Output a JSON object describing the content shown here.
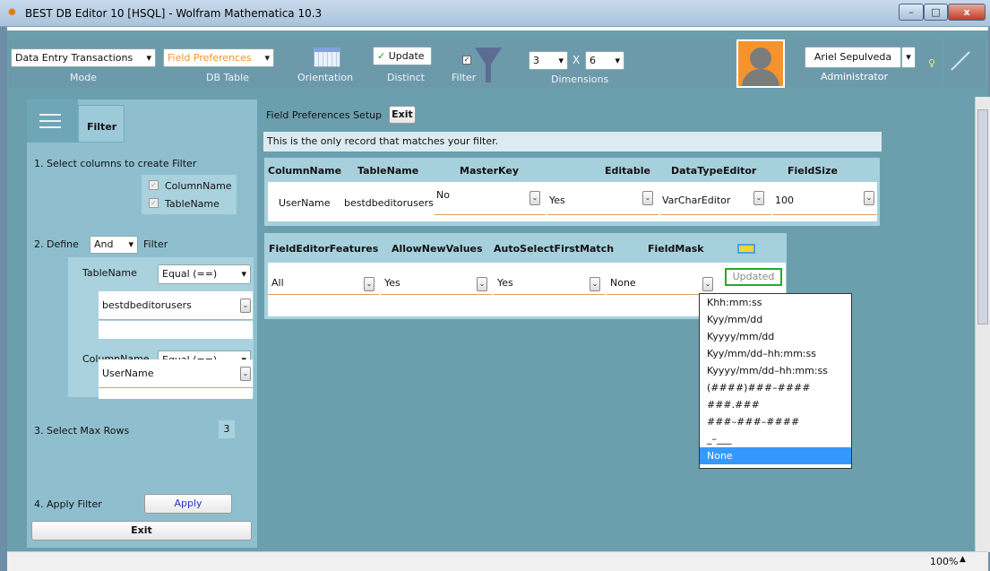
{
  "window": {
    "title": "BEST DB Editor 10 [HSQL] - Wolfram Mathematica 10.3",
    "min": "–",
    "max": "□",
    "close": "x"
  },
  "toolbar": {
    "mode_value": "Data Entry Transactions",
    "mode_label": "Mode",
    "table_value": "Field Preferences",
    "table_label": "DB Table",
    "orientation_label": "Orientation",
    "update_label": "Update",
    "distinct_label": "Distinct",
    "filter_label": "Filter",
    "dim_rows": "3",
    "dim_x": "X",
    "dim_cols": "6",
    "dim_label": "Dimensions",
    "user_name": "Ariel Sepulveda",
    "user_role": "Administrator"
  },
  "sidebar": {
    "tab_label": "Filter",
    "step1": "1.  Select columns to create Filter",
    "cols": [
      "ColumnName",
      "TableName"
    ],
    "step2_prefix": "2.  Define",
    "step2_op": "And",
    "step2_suffix": "Filter",
    "f1_name": "TableName",
    "f1_op": "Equal (==)",
    "f1_value": "bestdbeditorusers",
    "f2_name": "ColumnName",
    "f2_op": "Equal (==)",
    "f2_value": "UserName",
    "step3": "3.  Select Max Rows",
    "max_rows": "3",
    "step4": "4.  Apply Filter",
    "apply": "Apply",
    "exit": "Exit"
  },
  "main": {
    "setup_title": "Field Preferences Setup",
    "exit": "Exit",
    "message": "This is the only record that matches your filter.",
    "t1_headers": [
      "ColumnName",
      "TableName",
      "MasterKey",
      "Editable",
      "DataTypeEditor",
      "FieldSize"
    ],
    "t1_row": {
      "col": "UserName",
      "table": "bestdbeditorusers",
      "masterkey": "No",
      "editable": "Yes",
      "datatype": "VarCharEditor",
      "fieldsize": "100"
    },
    "t2_headers": [
      "FieldEditorFeatures",
      "AllowNewValues",
      "AutoSelectFirstMatch",
      "FieldMask"
    ],
    "t2_row": {
      "features": "All",
      "allownew": "Yes",
      "autoselect": "Yes",
      "mask": "None"
    },
    "updated": "Updated"
  },
  "popup": {
    "items": [
      "Khh:mm:ss",
      "Kyy/mm/dd",
      "Kyyyy/mm/dd",
      "Kyy/mm/dd–hh:mm:ss",
      "Kyyyy/mm/dd–hh:mm:ss",
      "(####)###–####",
      "###.###",
      "###–###–####",
      "_–___",
      "None"
    ],
    "selected_index": 9
  },
  "status": {
    "zoom": "100%"
  },
  "colors": {
    "accent": "#3399ff",
    "toolbar": "#6d9aab",
    "panel": "#8fbfcf",
    "orange": "#f7932b"
  }
}
